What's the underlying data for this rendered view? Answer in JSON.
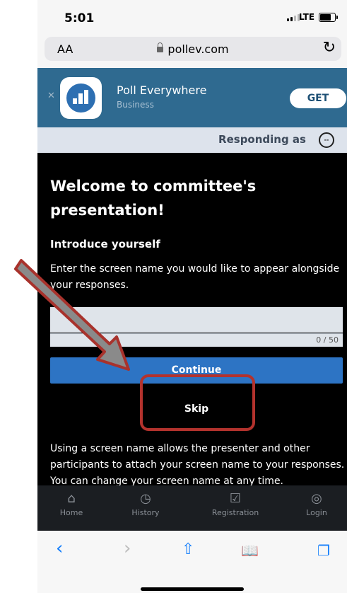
{
  "status_bar": {
    "time": "5:01",
    "network": "LTE"
  },
  "url_bar": {
    "text_size": "AA",
    "domain": "pollev.com"
  },
  "app_banner": {
    "name": "Poll Everywhere",
    "category": "Business",
    "get_label": "GET"
  },
  "responding": {
    "label": "Responding as",
    "avatar": "--"
  },
  "main": {
    "title": "Welcome to committee's presentation!",
    "intro_heading": "Introduce yourself",
    "intro_description": "Enter the screen name you would like to appear alongside your responses.",
    "screen_name_value": "",
    "char_counter": "0 / 50",
    "continue_label": "Continue",
    "skip_label": "Skip",
    "footer_text": "Using a screen name allows the presenter and other participants to attach your screen name to your responses. You can change your screen name at any time."
  },
  "app_nav": {
    "items": [
      {
        "label": "Home",
        "icon": "home-icon"
      },
      {
        "label": "History",
        "icon": "history-icon"
      },
      {
        "label": "Registration",
        "icon": "registration-icon"
      },
      {
        "label": "Login",
        "icon": "login-icon"
      }
    ]
  },
  "safari_toolbar": {
    "icons": [
      "back-icon",
      "forward-icon",
      "share-icon",
      "bookmarks-icon",
      "tabs-icon"
    ]
  },
  "colors": {
    "banner": "#2f6a90",
    "primary_button": "#2d74c4",
    "annotation": "#b3322d",
    "main_background": "#000000"
  }
}
